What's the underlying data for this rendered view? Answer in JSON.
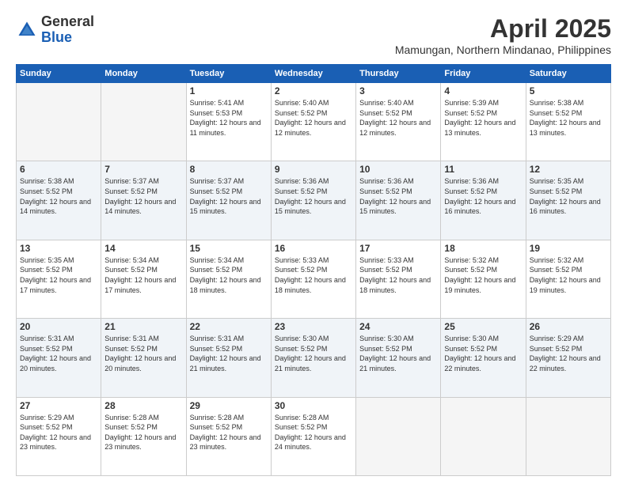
{
  "header": {
    "logo_general": "General",
    "logo_blue": "Blue",
    "title": "April 2025",
    "subtitle": "Mamungan, Northern Mindanao, Philippines"
  },
  "days_of_week": [
    "Sunday",
    "Monday",
    "Tuesday",
    "Wednesday",
    "Thursday",
    "Friday",
    "Saturday"
  ],
  "weeks": [
    {
      "days": [
        {
          "num": "",
          "empty": true
        },
        {
          "num": "",
          "empty": true
        },
        {
          "num": "1",
          "sunrise": "5:41 AM",
          "sunset": "5:53 PM",
          "daylight": "12 hours and 11 minutes."
        },
        {
          "num": "2",
          "sunrise": "5:40 AM",
          "sunset": "5:52 PM",
          "daylight": "12 hours and 12 minutes."
        },
        {
          "num": "3",
          "sunrise": "5:40 AM",
          "sunset": "5:52 PM",
          "daylight": "12 hours and 12 minutes."
        },
        {
          "num": "4",
          "sunrise": "5:39 AM",
          "sunset": "5:52 PM",
          "daylight": "12 hours and 13 minutes."
        },
        {
          "num": "5",
          "sunrise": "5:38 AM",
          "sunset": "5:52 PM",
          "daylight": "12 hours and 13 minutes."
        }
      ]
    },
    {
      "alt": true,
      "days": [
        {
          "num": "6",
          "sunrise": "5:38 AM",
          "sunset": "5:52 PM",
          "daylight": "12 hours and 14 minutes."
        },
        {
          "num": "7",
          "sunrise": "5:37 AM",
          "sunset": "5:52 PM",
          "daylight": "12 hours and 14 minutes."
        },
        {
          "num": "8",
          "sunrise": "5:37 AM",
          "sunset": "5:52 PM",
          "daylight": "12 hours and 15 minutes."
        },
        {
          "num": "9",
          "sunrise": "5:36 AM",
          "sunset": "5:52 PM",
          "daylight": "12 hours and 15 minutes."
        },
        {
          "num": "10",
          "sunrise": "5:36 AM",
          "sunset": "5:52 PM",
          "daylight": "12 hours and 15 minutes."
        },
        {
          "num": "11",
          "sunrise": "5:36 AM",
          "sunset": "5:52 PM",
          "daylight": "12 hours and 16 minutes."
        },
        {
          "num": "12",
          "sunrise": "5:35 AM",
          "sunset": "5:52 PM",
          "daylight": "12 hours and 16 minutes."
        }
      ]
    },
    {
      "days": [
        {
          "num": "13",
          "sunrise": "5:35 AM",
          "sunset": "5:52 PM",
          "daylight": "12 hours and 17 minutes."
        },
        {
          "num": "14",
          "sunrise": "5:34 AM",
          "sunset": "5:52 PM",
          "daylight": "12 hours and 17 minutes."
        },
        {
          "num": "15",
          "sunrise": "5:34 AM",
          "sunset": "5:52 PM",
          "daylight": "12 hours and 18 minutes."
        },
        {
          "num": "16",
          "sunrise": "5:33 AM",
          "sunset": "5:52 PM",
          "daylight": "12 hours and 18 minutes."
        },
        {
          "num": "17",
          "sunrise": "5:33 AM",
          "sunset": "5:52 PM",
          "daylight": "12 hours and 18 minutes."
        },
        {
          "num": "18",
          "sunrise": "5:32 AM",
          "sunset": "5:52 PM",
          "daylight": "12 hours and 19 minutes."
        },
        {
          "num": "19",
          "sunrise": "5:32 AM",
          "sunset": "5:52 PM",
          "daylight": "12 hours and 19 minutes."
        }
      ]
    },
    {
      "alt": true,
      "days": [
        {
          "num": "20",
          "sunrise": "5:31 AM",
          "sunset": "5:52 PM",
          "daylight": "12 hours and 20 minutes."
        },
        {
          "num": "21",
          "sunrise": "5:31 AM",
          "sunset": "5:52 PM",
          "daylight": "12 hours and 20 minutes."
        },
        {
          "num": "22",
          "sunrise": "5:31 AM",
          "sunset": "5:52 PM",
          "daylight": "12 hours and 21 minutes."
        },
        {
          "num": "23",
          "sunrise": "5:30 AM",
          "sunset": "5:52 PM",
          "daylight": "12 hours and 21 minutes."
        },
        {
          "num": "24",
          "sunrise": "5:30 AM",
          "sunset": "5:52 PM",
          "daylight": "12 hours and 21 minutes."
        },
        {
          "num": "25",
          "sunrise": "5:30 AM",
          "sunset": "5:52 PM",
          "daylight": "12 hours and 22 minutes."
        },
        {
          "num": "26",
          "sunrise": "5:29 AM",
          "sunset": "5:52 PM",
          "daylight": "12 hours and 22 minutes."
        }
      ]
    },
    {
      "days": [
        {
          "num": "27",
          "sunrise": "5:29 AM",
          "sunset": "5:52 PM",
          "daylight": "12 hours and 23 minutes."
        },
        {
          "num": "28",
          "sunrise": "5:28 AM",
          "sunset": "5:52 PM",
          "daylight": "12 hours and 23 minutes."
        },
        {
          "num": "29",
          "sunrise": "5:28 AM",
          "sunset": "5:52 PM",
          "daylight": "12 hours and 23 minutes."
        },
        {
          "num": "30",
          "sunrise": "5:28 AM",
          "sunset": "5:52 PM",
          "daylight": "12 hours and 24 minutes."
        },
        {
          "num": "",
          "empty": true
        },
        {
          "num": "",
          "empty": true
        },
        {
          "num": "",
          "empty": true
        }
      ]
    }
  ],
  "labels": {
    "sunrise": "Sunrise:",
    "sunset": "Sunset:",
    "daylight": "Daylight:"
  }
}
